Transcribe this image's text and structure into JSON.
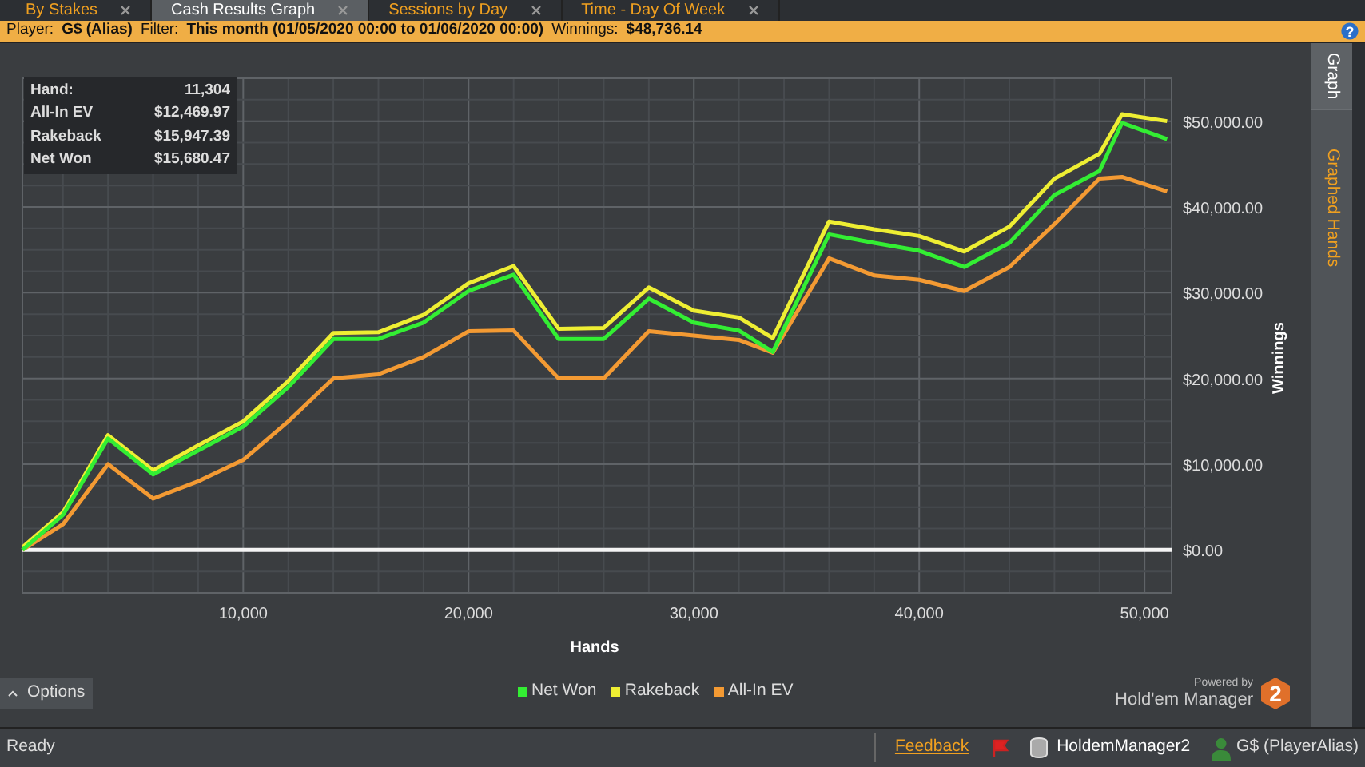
{
  "tabs": [
    {
      "label": "By Stakes",
      "selected": false
    },
    {
      "label": "Cash Results Graph",
      "selected": true
    },
    {
      "label": "Sessions by Day",
      "selected": false
    },
    {
      "label": "Time - Day Of Week",
      "selected": false
    }
  ],
  "filter_bar": {
    "fields": [
      {
        "label": "Player:",
        "value": "G$ (Alias)"
      },
      {
        "label": "Filter:",
        "value": "This month (01/05/2020 00:00 to 01/06/2020 00:00)"
      },
      {
        "label": "Winnings:",
        "value": "$48,736.14"
      }
    ],
    "help": "?"
  },
  "side_tabs": [
    {
      "label": "Graph",
      "selected": true
    },
    {
      "label": "Graphed Hands",
      "selected": false
    }
  ],
  "tooltip": [
    {
      "label": "Hand:",
      "value": "11,304"
    },
    {
      "label": "All-In EV",
      "value": "$12,469.97"
    },
    {
      "label": "Rakeback",
      "value": "$15,947.39"
    },
    {
      "label": "Net Won",
      "value": "$15,680.47"
    }
  ],
  "chart_data": {
    "type": "line",
    "grid": true,
    "xlabel": "Hands",
    "ylabel": "Winnings",
    "x": [
      200,
      2000,
      4000,
      6000,
      8000,
      10000,
      12000,
      14000,
      16000,
      18000,
      20000,
      22000,
      24000,
      26000,
      28000,
      30000,
      32000,
      33500,
      36000,
      38000,
      40000,
      42000,
      44000,
      46000,
      48000,
      49000,
      51000
    ],
    "series": [
      {
        "name": "Net Won",
        "color": "#33ee33",
        "values": [
          0,
          4100,
          13000,
          8800,
          11600,
          14400,
          19000,
          24600,
          24600,
          26500,
          30200,
          32100,
          24600,
          24600,
          29300,
          26500,
          25600,
          23100,
          36800,
          35800,
          34900,
          33000,
          35800,
          41400,
          44200,
          49800,
          47900
        ]
      },
      {
        "name": "Rakeback",
        "color": "#eeee33",
        "values": [
          300,
          4400,
          13400,
          9300,
          12200,
          15000,
          19700,
          25300,
          25400,
          27400,
          31100,
          33100,
          25800,
          25900,
          30600,
          27900,
          27100,
          24700,
          38300,
          37400,
          36600,
          34800,
          37700,
          43300,
          46200,
          50800,
          50000
        ]
      },
      {
        "name": "All-In EV",
        "color": "#f39a33",
        "values": [
          0,
          3000,
          10000,
          6000,
          8000,
          10500,
          15000,
          20000,
          20500,
          22500,
          25500,
          25600,
          20000,
          20000,
          25500,
          25000,
          24500,
          23000,
          34000,
          32000,
          31500,
          30200,
          33000,
          38000,
          43300,
          43500,
          41800
        ]
      }
    ],
    "xlim": [
      200,
      51200
    ],
    "ylim": [
      -5000,
      55000
    ],
    "xticks": [
      {
        "value": 10000,
        "label": "10,000"
      },
      {
        "value": 20000,
        "label": "20,000"
      },
      {
        "value": 30000,
        "label": "30,000"
      },
      {
        "value": 40000,
        "label": "40,000"
      },
      {
        "value": 50000,
        "label": "50,000"
      }
    ],
    "yticks": [
      {
        "value": 0,
        "label": "$0.00"
      },
      {
        "value": 10000,
        "label": "$10,000.00"
      },
      {
        "value": 20000,
        "label": "$20,000.00"
      },
      {
        "value": 30000,
        "label": "$30,000.00"
      },
      {
        "value": 40000,
        "label": "$40,000.00"
      },
      {
        "value": 50000,
        "label": "$50,000.00"
      }
    ]
  },
  "options_button": "Options",
  "logo": {
    "powered_by": "Powered by",
    "name": "Hold'em Manager",
    "badge": "2"
  },
  "status_bar": {
    "status": "Ready",
    "feedback": "Feedback",
    "database": "HoldemManager2",
    "player": "G$ (PlayerAlias)"
  }
}
